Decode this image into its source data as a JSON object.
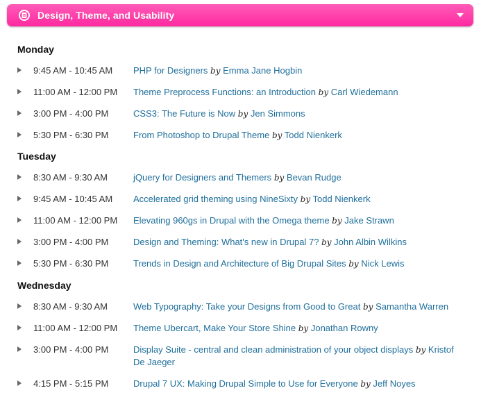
{
  "header": {
    "title": "Design, Theme, and Usability",
    "icon": "track-badge-icon",
    "toggle_icon": "chevron-down-icon",
    "color": "#ff3aa8"
  },
  "by_label": "by",
  "days": [
    {
      "name": "Monday",
      "sessions": [
        {
          "time": "9:45 AM - 10:45 AM",
          "title": "PHP for Designers",
          "speaker": "Emma Jane Hogbin"
        },
        {
          "time": "11:00 AM - 12:00 PM",
          "title": "Theme Preprocess Functions: an Introduction",
          "speaker": "Carl Wiedemann"
        },
        {
          "time": "3:00 PM - 4:00 PM",
          "title": "CSS3: The Future is Now",
          "speaker": "Jen Simmons"
        },
        {
          "time": "5:30 PM - 6:30 PM",
          "title": "From Photoshop to Drupal Theme",
          "speaker": "Todd Nienkerk"
        }
      ]
    },
    {
      "name": "Tuesday",
      "sessions": [
        {
          "time": "8:30 AM - 9:30 AM",
          "title": "jQuery for Designers and Themers",
          "speaker": "Bevan Rudge"
        },
        {
          "time": "9:45 AM - 10:45 AM",
          "title": "Accelerated grid theming using NineSixty",
          "speaker": "Todd Nienkerk"
        },
        {
          "time": "11:00 AM - 12:00 PM",
          "title": "Elevating 960gs in Drupal with the Omega theme",
          "speaker": "Jake Strawn"
        },
        {
          "time": "3:00 PM - 4:00 PM",
          "title": "Design and Theming: What's new in Drupal 7?",
          "speaker": "John Albin Wilkins"
        },
        {
          "time": "5:30 PM - 6:30 PM",
          "title": "Trends in Design and Architecture of Big Drupal Sites",
          "speaker": "Nick Lewis"
        }
      ]
    },
    {
      "name": "Wednesday",
      "sessions": [
        {
          "time": "8:30 AM - 9:30 AM",
          "title": "Web Typography: Take your Designs from Good to Great",
          "speaker": "Samantha Warren"
        },
        {
          "time": "11:00 AM - 12:00 PM",
          "title": "Theme Ubercart, Make Your Store Shine",
          "speaker": "Jonathan Rowny"
        },
        {
          "time": "3:00 PM - 4:00 PM",
          "title": "Display Suite - central and clean administration of your object displays",
          "speaker": "Kristof De Jaeger"
        },
        {
          "time": "4:15 PM - 5:15 PM",
          "title": "Drupal 7 UX: Making Drupal Simple to Use for Everyone",
          "speaker": "Jeff Noyes"
        }
      ]
    }
  ]
}
